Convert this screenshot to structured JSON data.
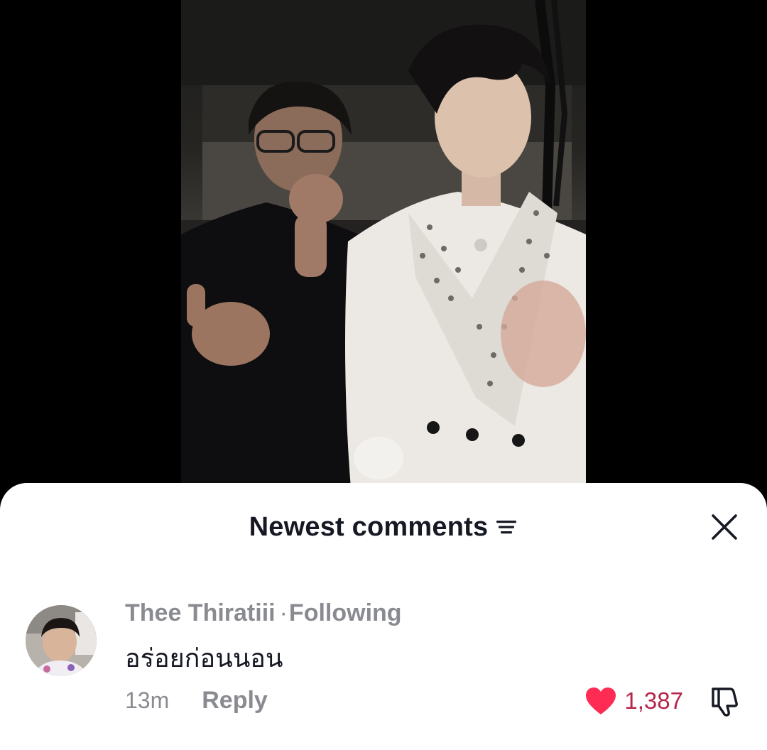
{
  "sheet": {
    "title": "Newest comments",
    "sort_icon": "sort-lines-icon",
    "close_icon": "close-icon"
  },
  "comment": {
    "author": "Thee Thiratiii",
    "separator": "·",
    "relation": "Following",
    "text": "อร่อยก่อนนอน",
    "time": "13m",
    "reply_label": "Reply",
    "like_count": "1,387",
    "liked": true,
    "like_color": "#fe2c55",
    "like_icon": "heart-icon",
    "dislike_icon": "dislike-icon"
  }
}
